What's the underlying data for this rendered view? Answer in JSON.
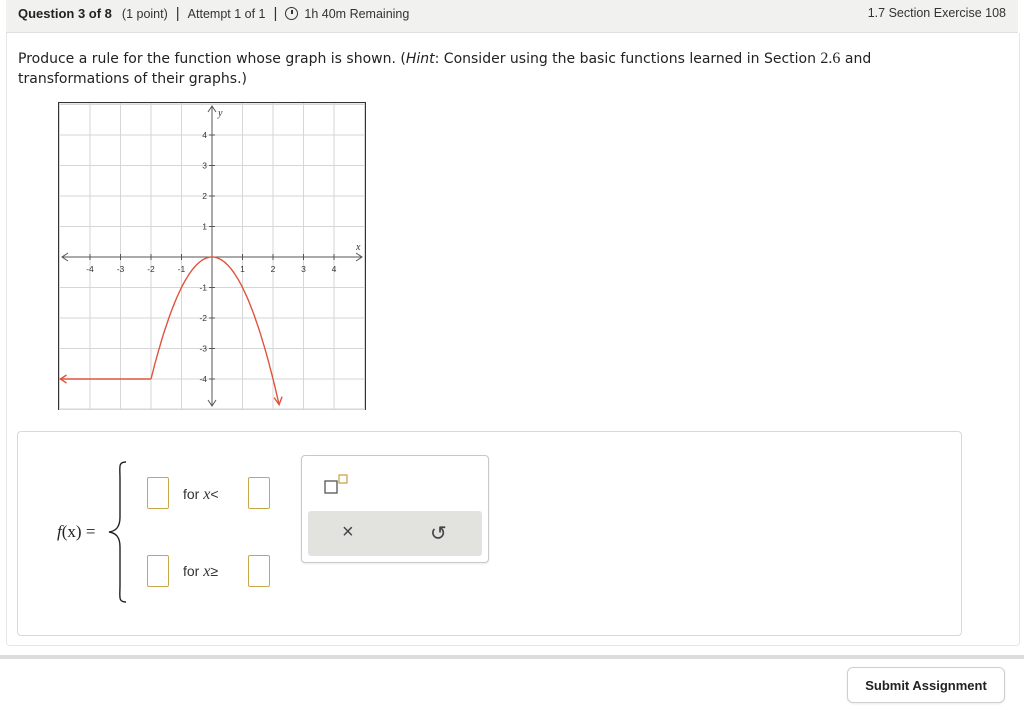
{
  "header": {
    "question": "Question 3 of 8",
    "points": "(1 point)",
    "attempt": "Attempt 1 of 1",
    "separator": "|",
    "time_remaining": "1h 40m Remaining",
    "section": "1.7 Section Exercise 108"
  },
  "question": {
    "prefix": "Produce a rule for the function whose graph is shown. (",
    "hint_label": "Hint",
    "middle": ": Consider using the basic functions learned in Section ",
    "section_ref": "2.6",
    "suffix": " and transformations of their graphs.)"
  },
  "graph": {
    "x_label": "x",
    "y_label": "y",
    "x_ticks": [
      "-4",
      "-3",
      "-2",
      "-1",
      "1",
      "2",
      "3",
      "4"
    ],
    "y_ticks": [
      "4",
      "3",
      "2",
      "1",
      "-1",
      "-2",
      "-3",
      "-4"
    ],
    "curve_color": "#e0533d",
    "grid_color": "#d6d6d6"
  },
  "answer": {
    "function_name": "f",
    "variable": "(x)",
    "equals": "=",
    "row1_label": "for ",
    "row1_var": "x",
    "row1_op": "<",
    "row2_label": "for ",
    "row2_var": "x",
    "row2_op": "≥"
  },
  "palette": {
    "exponent_icon": "superscript-icon",
    "clear_symbol": "×",
    "undo_symbol": "↺"
  },
  "submit_label": "Submit Assignment"
}
